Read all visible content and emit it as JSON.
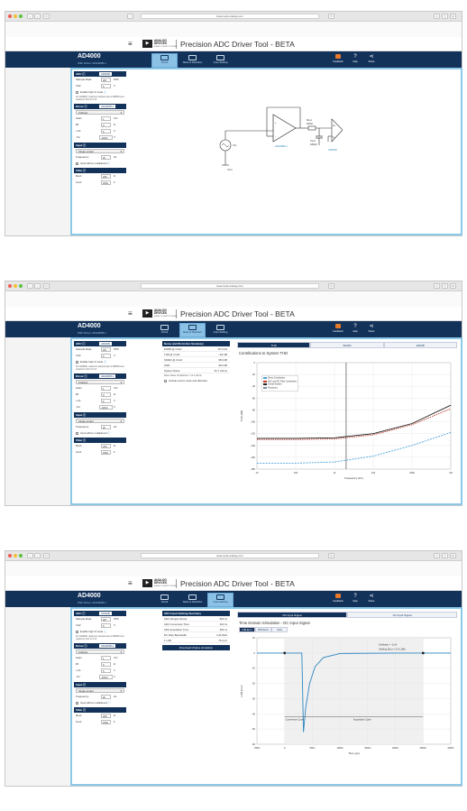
{
  "browser": {
    "url": "beta-tools.analog.com"
  },
  "header": {
    "logo_mark": "▶",
    "logo_line1": "ANALOG",
    "logo_line2": "DEVICES",
    "logo_tagline": "AHEAD OF WHAT'S POSSIBLE",
    "app_title": "Precision ADC Driver Tool - BETA"
  },
  "bar": {
    "product": "AD4000",
    "driver_line": "With Driver: ADA4805-1",
    "tabs": [
      "Circuit",
      "Noise & Distortion",
      "Input Settling"
    ],
    "right": [
      {
        "label": "Feedback"
      },
      {
        "label": "Help",
        "glyph": "?"
      },
      {
        "label": "Share",
        "glyph": "⋖"
      }
    ]
  },
  "sidebar": {
    "adc": {
      "title": "ADC",
      "value": "AD4000"
    },
    "sample_rate": {
      "label": "Sample Rate:",
      "value": "2M",
      "unit": "SPS"
    },
    "vref": {
      "label": "Vref:",
      "value": "5",
      "unit": "V"
    },
    "high_z": "Enable high-Z mode",
    "note": "For AD4000, maximum sample rate is 2MSPS and maximum Vref is 5.1V",
    "driver": {
      "title": "Driver",
      "value": "ADA4805-1"
    },
    "driver_mode": "Follower",
    "gain": {
      "label": "Gain:",
      "value": "1",
      "unit": "V/V"
    },
    "rf": {
      "label": "Rf:",
      "value": "0",
      "unit": "Ω"
    },
    "vs_pos": {
      "label": "+Vs:",
      "value": "6",
      "unit": "V"
    },
    "vs_neg": {
      "label": "-Vs:",
      "value": "-400m",
      "unit": "V"
    },
    "input": {
      "title": "Input"
    },
    "input_mode": "Single-ended",
    "frequency": {
      "label": "Frequency:",
      "value": "2k",
      "unit": "Hz"
    },
    "multiplexed": "Input will be multiplexed",
    "filter": {
      "title": "Filter"
    },
    "rext": {
      "label": "Rext:",
      "value": "200",
      "unit": "Ω"
    },
    "cext": {
      "label": "Cext:",
      "value": "180p",
      "unit": "F"
    }
  },
  "circuit": {
    "vin": "Vin",
    "vcm": "Vcm",
    "driver": "ADA4805-1",
    "rext": "Rext",
    "rext_val": "200Ω",
    "cext": "Cext",
    "cext_val": "180pF",
    "adc": "AD4000",
    "in_p": "In+",
    "in_m": "In-"
  },
  "noise": {
    "summary_title": "Noise and Distortion Summary",
    "rows": [
      {
        "label": "ENOB @ 2 kHz:",
        "value": "16.1 bits"
      },
      {
        "label": "THD @ 2 kHz:",
        "value": "-112 dB"
      },
      {
        "label": "SINAD @ 2 kHz:",
        "value": "98.9 dB"
      },
      {
        "label": "SNR:",
        "value": "99.0 dB"
      },
      {
        "label": "System Noise:",
        "value": "61.7 μVrms"
      }
    ],
    "driver_contrib": "Driver Noise Contribution = 12.1 μVrms",
    "include_label": "Include source noise and distortion",
    "tabs": [
      "THD",
      "SINAD",
      "ENOB"
    ],
    "chart_title": "Contributions to System THD"
  },
  "settling": {
    "summary_title": "ADC Input Settling Summary",
    "rows": [
      {
        "label": "ADC Sample Period:",
        "value": "500 ns"
      },
      {
        "label": "ADC Conversion Time:",
        "value": "310 ns"
      },
      {
        "label": "ADC Acquisition Time:",
        "value": "290 ns"
      },
      {
        "label": "RC Filter Bandwidth:",
        "value": "4.42 MHz"
      },
      {
        "label": "1 LSB:",
        "value": "76.3 μV"
      }
    ],
    "download": "Download LTspice simulation",
    "tabs": [
      "DC Input Signal",
      "AC Input Signal"
    ],
    "subtabs": [
      "LSB Error",
      "PPM Error",
      "Volts"
    ],
    "chart_title": "Time Domain Simulation - DC Input Signal",
    "kickback_line1": "Kickback = -1mV",
    "kickback_line2": "Settling Error = 0.3 LSBs",
    "conversion": "Conversion Cycle",
    "acquisition": "Acquisition Cycle"
  },
  "chart_data": [
    {
      "type": "line",
      "title": "Contributions to System THD",
      "xlabel": "Frequency (Hz)",
      "ylabel": "THD (dB)",
      "xscale": "log",
      "x": [
        10,
        100,
        1000,
        10000,
        100000,
        1000000
      ],
      "x_tick_labels": [
        "10",
        "100",
        "1k",
        "10k",
        "100k",
        "1M"
      ],
      "y_tick_labels": [
        "0",
        "-20",
        "-40",
        "-60",
        "-80",
        "-100",
        "-120",
        "-140",
        "-160",
        "-180"
      ],
      "ylim": [
        -180,
        0
      ],
      "grid": true,
      "legend_position": "top-left",
      "series": [
        {
          "name": "Driver Contribution",
          "color": "#4aa3df",
          "values": [
            -170,
            -170,
            -168,
            -158,
            -140,
            -118
          ]
        },
        {
          "name": "ADC and RC Filter Contribution",
          "color": "#c0392b",
          "values": [
            -130,
            -130,
            -129,
            -122,
            -105,
            -78
          ]
        },
        {
          "name": "Overall System",
          "color": "#222222",
          "values": [
            -128,
            -128,
            -127,
            -120,
            -103,
            -72
          ]
        },
        {
          "name": "Frequency",
          "color": "#7f8c9a",
          "values": []
        }
      ],
      "marker_x": 2000
    },
    {
      "type": "line",
      "title": "Time Domain Simulation - DC Input Signal",
      "xlabel": "Time (μs)",
      "ylabel": "LSB Error",
      "x_tick_labels": [
        "-500n",
        "0",
        "500n",
        "1000n",
        "1500n",
        "2000n",
        "2500n",
        "3000n"
      ],
      "y_tick_labels": [
        "10",
        "0",
        "-10",
        "-20",
        "-30",
        "-40",
        "-50",
        "-60"
      ],
      "ylim": [
        -60,
        10
      ],
      "series": [
        {
          "name": "LSB Error",
          "color": "#2e86c1",
          "x": [
            -0.5,
            0,
            0.3,
            0.31,
            0.34,
            0.38,
            0.45,
            0.55,
            0.7,
            1.0,
            2.0,
            3.0
          ],
          "values": [
            0,
            0,
            0,
            0,
            -52,
            -36,
            -20,
            -9,
            -3,
            -0.3,
            0,
            0
          ]
        }
      ]
    }
  ]
}
